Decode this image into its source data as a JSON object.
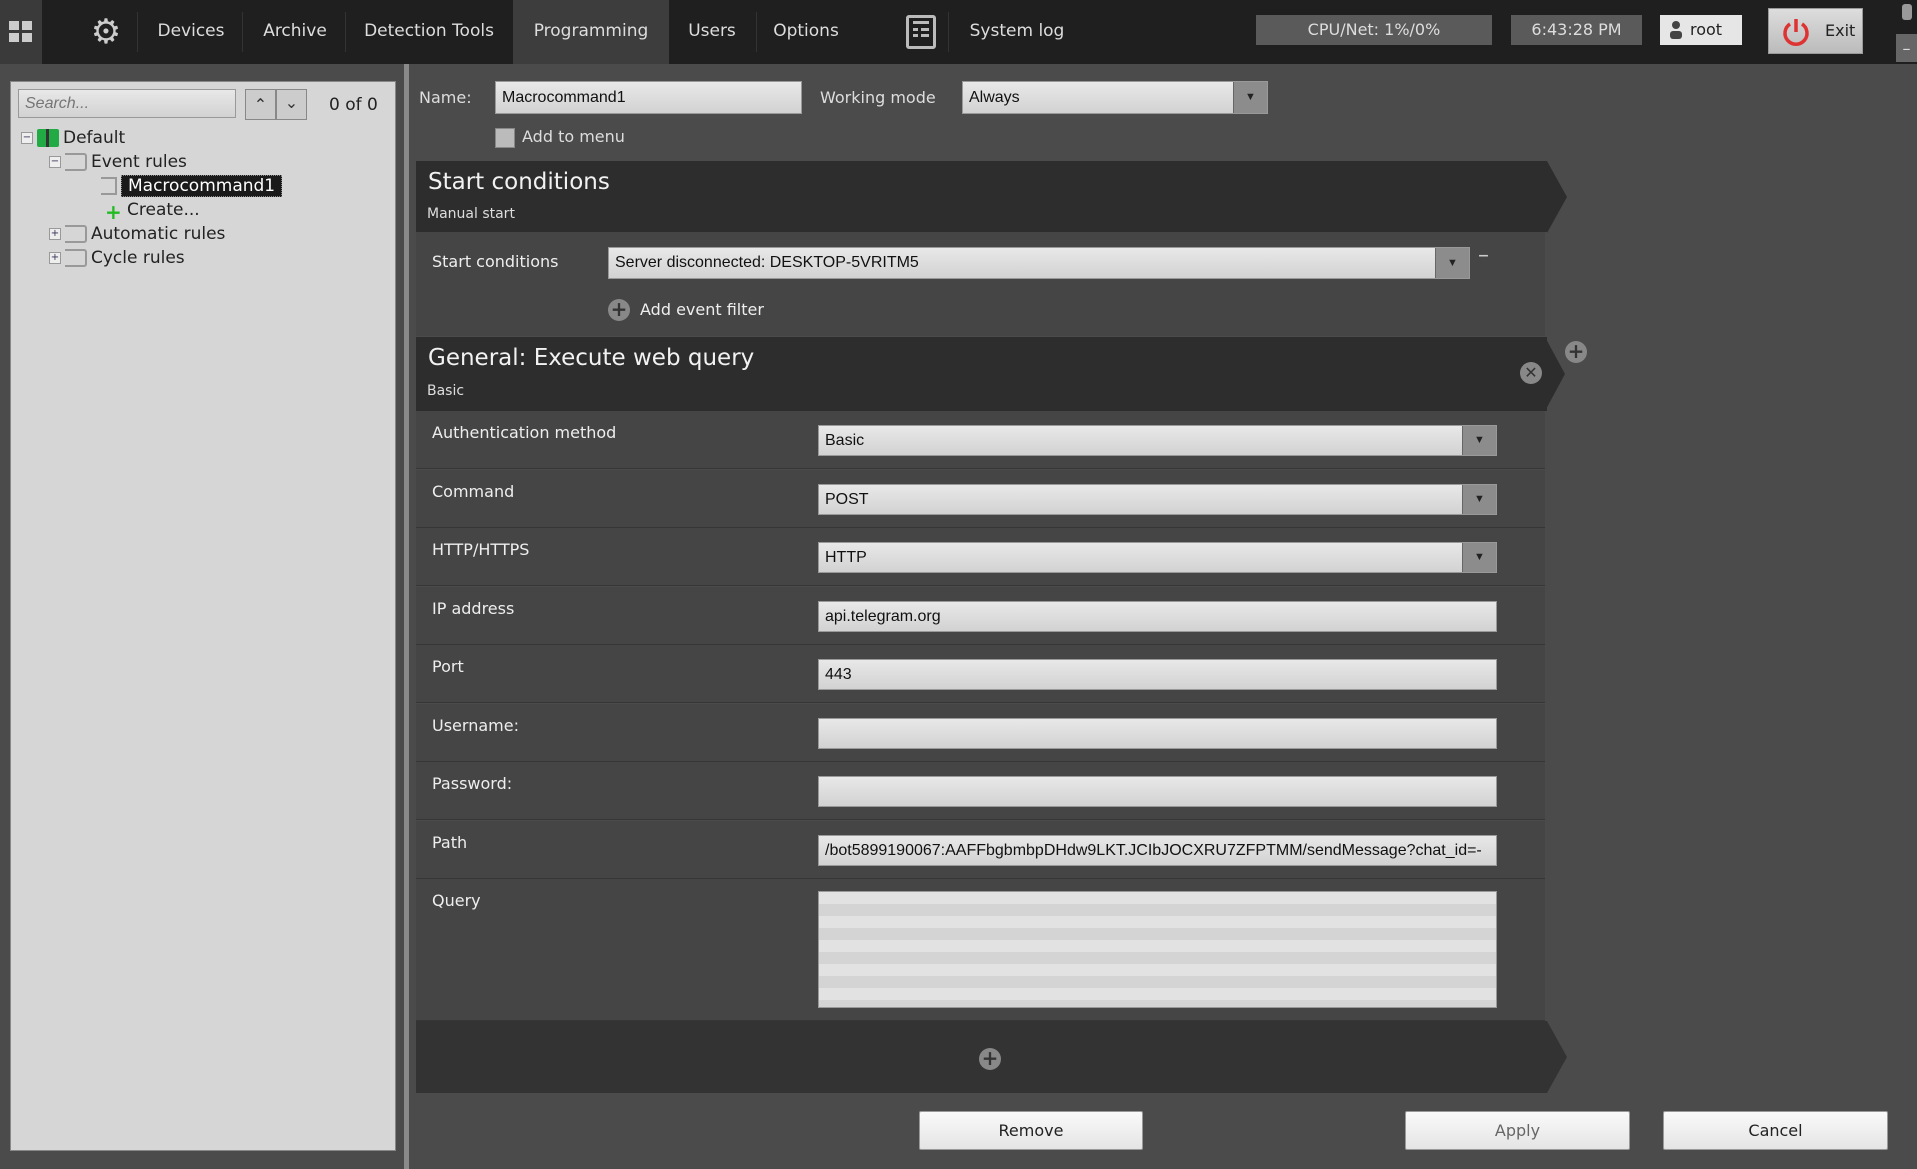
{
  "topbar": {
    "tabs": [
      "Devices",
      "Archive",
      "Detection Tools",
      "Programming",
      "Users",
      "Options"
    ],
    "active_tab": "Programming",
    "system_log": "System log",
    "cpu": "CPU/Net: 1%/0%",
    "time": "6:43:28 PM",
    "user": "root",
    "exit": "Exit"
  },
  "sidebar": {
    "search_placeholder": "Search...",
    "counter": "0 of 0",
    "tree": {
      "root": "Default",
      "event_rules": "Event rules",
      "macro": "Macrocommand1",
      "create": "Create...",
      "automatic": "Automatic rules",
      "cycle": "Cycle rules"
    }
  },
  "form": {
    "name_label": "Name:",
    "name_value": "Macrocommand1",
    "working_mode_label": "Working mode",
    "working_mode_value": "Always",
    "add_to_menu": "Add to menu"
  },
  "start": {
    "title": "Start conditions",
    "subtitle": "Manual start",
    "label": "Start conditions",
    "value": "Server disconnected: DESKTOP-5VRITM5",
    "add_filter": "Add event filter"
  },
  "action": {
    "title": "General: Execute web query",
    "subtitle": "Basic",
    "rows": [
      {
        "label": "Authentication method",
        "value": "Basic",
        "type": "select"
      },
      {
        "label": "Command",
        "value": "POST",
        "type": "select"
      },
      {
        "label": "HTTP/HTTPS",
        "value": "HTTP",
        "type": "select"
      },
      {
        "label": "IP address",
        "value": "api.telegram.org",
        "type": "input"
      },
      {
        "label": "Port",
        "value": "443",
        "type": "input"
      },
      {
        "label": "Username:",
        "value": "",
        "type": "input"
      },
      {
        "label": "Password:",
        "value": "",
        "type": "input"
      },
      {
        "label": "Path",
        "value": "/bot5899190067:AAFFbgbmbpDHdw9LKT.JCIbJOCXRU7ZFPTMM/sendMessage?chat_id=-",
        "type": "input"
      }
    ],
    "query_label": "Query",
    "query_value": ""
  },
  "buttons": {
    "remove": "Remove",
    "apply": "Apply",
    "cancel": "Cancel"
  }
}
